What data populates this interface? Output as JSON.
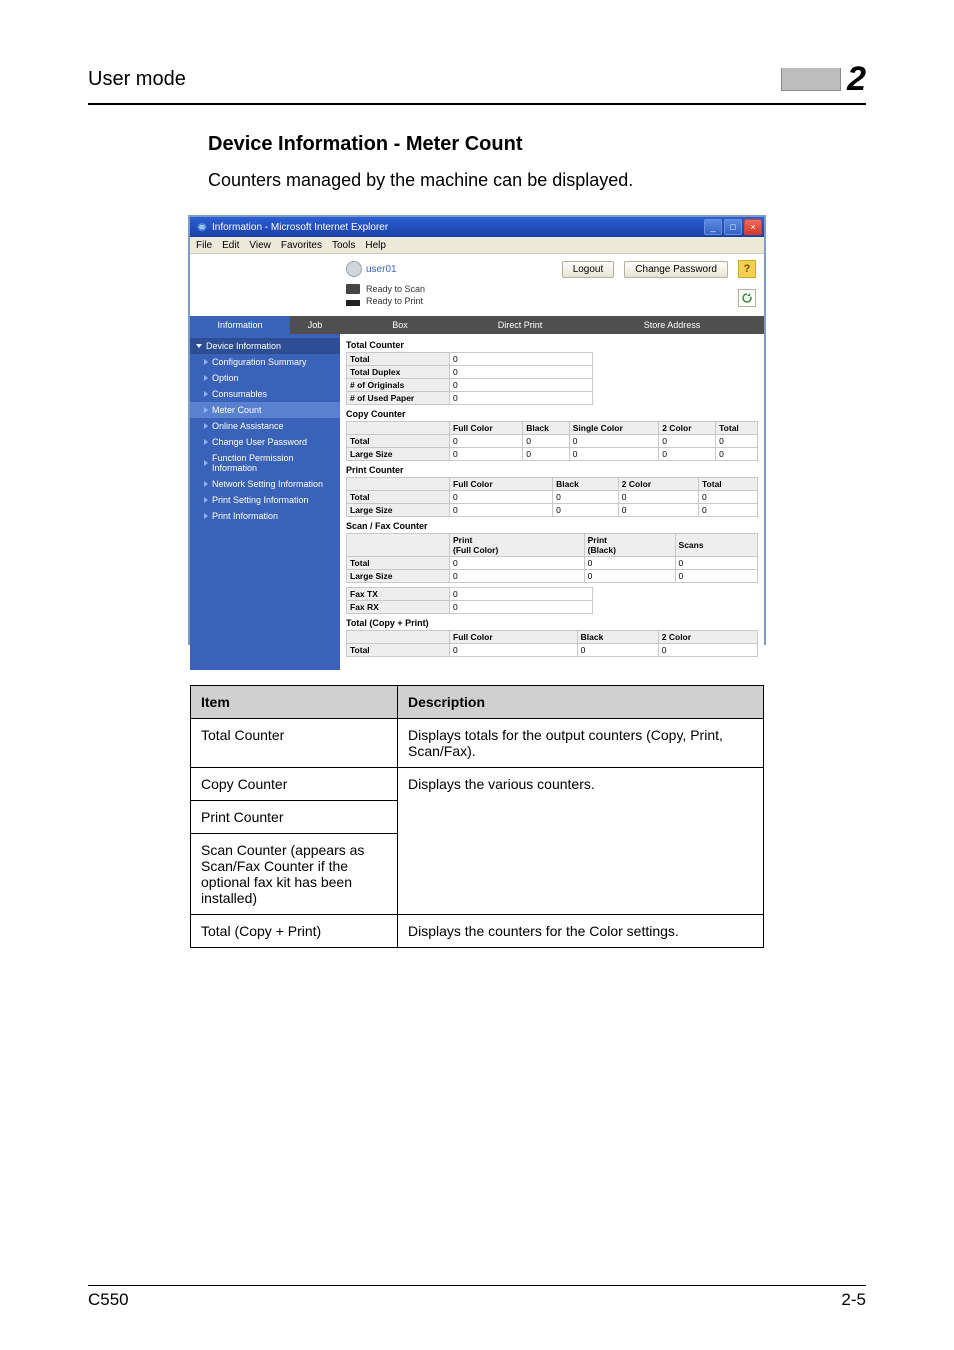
{
  "header": {
    "label": "User mode",
    "chapter": "2"
  },
  "section": {
    "title": "Device Information - Meter Count",
    "desc": "Counters managed by the machine can be displayed."
  },
  "screenshot": {
    "window_title": "Information - Microsoft Internet Explorer",
    "menus": [
      "File",
      "Edit",
      "View",
      "Favorites",
      "Tools",
      "Help"
    ],
    "user": "user01",
    "logout_btn": "Logout",
    "changepw_btn": "Change Password",
    "help_glyph": "?",
    "status": {
      "a": "Ready to Scan",
      "b": "Ready to Print"
    },
    "tabs": {
      "info": "Information",
      "job": "Job",
      "box": "Box",
      "dp": "Direct Print",
      "sa": "Store Address"
    },
    "sidebar": {
      "hd": "Device Information",
      "i1": "Configuration Summary",
      "i2": "Option",
      "i3": "Consumables",
      "i4": "Meter Count",
      "o1": "Online Assistance",
      "o2": "Change User Password",
      "o3": "Function Permission Information",
      "o4": "Network Setting Information",
      "o5": "Print Setting Information",
      "o6": "Print Information"
    },
    "counters": {
      "totalcounter_title": "Total Counter",
      "total_row": {
        "lbl": "Total",
        "v": "0"
      },
      "total_duplex": {
        "lbl": "Total Duplex",
        "v": "0"
      },
      "total_orig": {
        "lbl": "# of Originals",
        "v": "0"
      },
      "total_used": {
        "lbl": "# of Used Paper",
        "v": "0"
      },
      "copy_title": "Copy Counter",
      "cols5": {
        "c1": "Full Color",
        "c2": "Black",
        "c3": "Single Color",
        "c4": "2 Color",
        "c5": "Total"
      },
      "row_total5": {
        "lbl": "Total",
        "v1": "0",
        "v2": "0",
        "v3": "0",
        "v4": "0",
        "v5": "0"
      },
      "row_large5": {
        "lbl": "Large Size",
        "v1": "0",
        "v2": "0",
        "v3": "0",
        "v4": "0",
        "v5": "0"
      },
      "print_title": "Print Counter",
      "cols4": {
        "c1": "Full Color",
        "c2": "Black",
        "c3": "2 Color",
        "c4": "Total"
      },
      "prow_total": {
        "lbl": "Total",
        "v1": "0",
        "v2": "0",
        "v3": "0",
        "v4": "0"
      },
      "prow_large": {
        "lbl": "Large Size",
        "v1": "0",
        "v2": "0",
        "v3": "0",
        "v4": "0"
      },
      "scan_title": "Scan / Fax Counter",
      "scancols": {
        "c1": "Print\n(Full Color)",
        "c2": "Print\n(Black)",
        "c3": "Scans"
      },
      "srow_total": {
        "lbl": "Total",
        "v1": "0",
        "v2": "0",
        "v3": "0"
      },
      "srow_large": {
        "lbl": "Large Size",
        "v1": "0",
        "v2": "0",
        "v3": "0"
      },
      "fax_tx": {
        "lbl": "Fax TX",
        "v": "0"
      },
      "fax_rx": {
        "lbl": "Fax RX",
        "v": "0"
      },
      "tcp_title": "Total (Copy + Print)",
      "tcp_cols": {
        "c1": "Full Color",
        "c2": "Black",
        "c3": "2 Color"
      },
      "tcp_row": {
        "lbl": "Total",
        "v1": "0",
        "v2": "0",
        "v3": "0"
      }
    }
  },
  "table": {
    "h1": "Item",
    "h2": "Description",
    "r1": {
      "item": "Total Counter",
      "desc": "Displays totals for the output counters (Copy, Print, Scan/Fax)."
    },
    "r2": {
      "item": "Copy Counter",
      "desc": "Displays the various counters."
    },
    "r3": {
      "item": "Print Counter"
    },
    "r4": {
      "item": "Scan Counter (appears as Scan/Fax Counter if the optional fax kit has been installed)"
    },
    "r5": {
      "item": "Total (Copy + Print)",
      "desc": "Displays the counters for the Color settings."
    }
  },
  "footer": {
    "left": "C550",
    "right": "2-5"
  }
}
